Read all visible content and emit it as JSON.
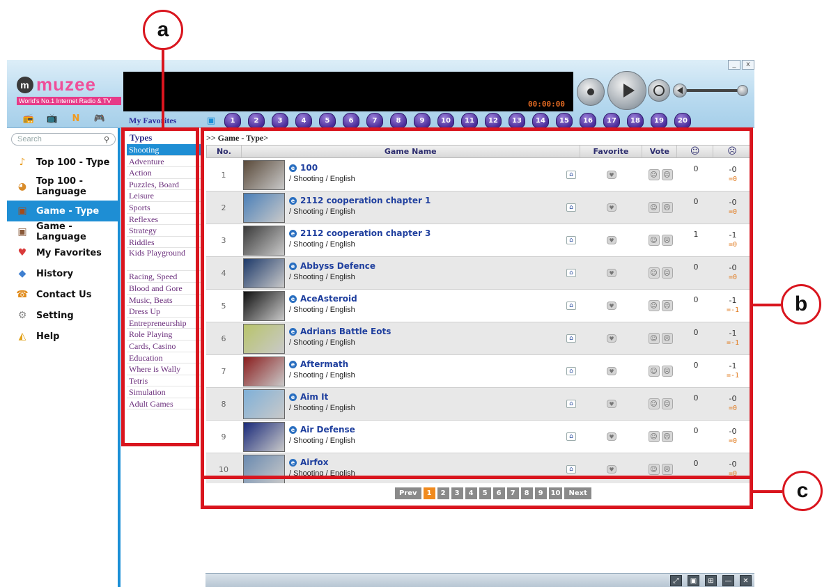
{
  "callouts": {
    "a": "a",
    "b": "b",
    "c": "c"
  },
  "app": {
    "logo": {
      "word": "muzee",
      "mark": "m",
      "tagline": "World's No.1 Internet Radio & TV"
    },
    "player": {
      "timer": "00:00:00"
    },
    "window_buttons": [
      "_",
      "x"
    ],
    "favorites": {
      "label": "My Favorites",
      "slots": [
        "1",
        "2",
        "3",
        "4",
        "5",
        "6",
        "7",
        "8",
        "9",
        "10",
        "11",
        "12",
        "13",
        "14",
        "15",
        "16",
        "17",
        "18",
        "19",
        "20"
      ]
    },
    "mode_icons": [
      {
        "name": "radio-icon",
        "glyph": "📻",
        "color": "#1b8fd6"
      },
      {
        "name": "tv-icon",
        "glyph": "📺",
        "color": "#d12a5c"
      },
      {
        "name": "news-icon",
        "glyph": "N",
        "color": "#f19a1e"
      },
      {
        "name": "game-icon",
        "glyph": "🎮",
        "color": "#d9307a"
      }
    ]
  },
  "sidebar": {
    "search_placeholder": "Search",
    "items": [
      {
        "label": "Top 100 - Type",
        "icon": "music-notes-icon",
        "glyph": "♪",
        "color": "#e89a1a"
      },
      {
        "label": "Top 100 - Language",
        "icon": "globe-notes-icon",
        "glyph": "◕",
        "color": "#d98c2a"
      },
      {
        "label": "Game - Type",
        "icon": "game-box-icon",
        "glyph": "▣",
        "color": "#a44c1a",
        "active": true
      },
      {
        "label": "Game - Language",
        "icon": "game-box-icon",
        "glyph": "▣",
        "color": "#8a5a3a"
      },
      {
        "label": "My Favorites",
        "icon": "heart-icon",
        "glyph": "♥",
        "color": "#d93a3a"
      },
      {
        "label": "History",
        "icon": "history-icon",
        "glyph": "◆",
        "color": "#3f7fd0"
      },
      {
        "label": "Contact Us",
        "icon": "contact-icon",
        "glyph": "☎",
        "color": "#e08a1a"
      },
      {
        "label": "Setting",
        "icon": "gear-icon",
        "glyph": "⚙",
        "color": "#8a8a8a"
      },
      {
        "label": "Help",
        "icon": "help-icon",
        "glyph": "◭",
        "color": "#e2a21a"
      }
    ]
  },
  "types": {
    "heading": "Types",
    "items": [
      "Shooting",
      "Adventure",
      "Action",
      "Puzzles, Board",
      "Leisure",
      "Sports",
      "Reflexes",
      "Strategy",
      "Riddles",
      "Kids Playground",
      "Racing, Speed",
      "Blood and Gore",
      "Music, Beats",
      "Dress Up",
      "Entrepreneurship",
      "Role Playing",
      "Cards, Casino",
      "Education",
      "Where is Wally",
      "Tetris",
      "Simulation",
      "Adult Games"
    ]
  },
  "main": {
    "breadcrumb": ">> Game - Type>",
    "columns": {
      "no": "No.",
      "name": "Game Name",
      "favorite": "Favorite",
      "vote": "Vote",
      "up": "☺",
      "down": "☹"
    },
    "games": [
      {
        "no": "1",
        "title": "100",
        "meta": "/ Shooting / English",
        "up": "0",
        "down": "-0",
        "score": "=0",
        "thumb": "#5a4a3a"
      },
      {
        "no": "2",
        "title": "2112 cooperation chapter 1",
        "meta": "/ Shooting / English",
        "up": "0",
        "down": "-0",
        "score": "=0",
        "thumb": "#4a7fb8"
      },
      {
        "no": "3",
        "title": "2112 cooperation chapter 3",
        "meta": "/ Shooting / English",
        "up": "1",
        "down": "-1",
        "score": "=0",
        "thumb": "#3a3a3a"
      },
      {
        "no": "4",
        "title": "Abbyss Defence",
        "meta": "/ Shooting / English",
        "up": "0",
        "down": "-0",
        "score": "=0",
        "thumb": "#1e3a6a"
      },
      {
        "no": "5",
        "title": "AceAsteroid",
        "meta": "/ Shooting / English",
        "up": "0",
        "down": "-1",
        "score": "=-1",
        "thumb": "#101010"
      },
      {
        "no": "6",
        "title": "Adrians Battle Eots",
        "meta": "/ Shooting / English",
        "up": "0",
        "down": "-1",
        "score": "=-1",
        "thumb": "#b8c46a"
      },
      {
        "no": "7",
        "title": "Aftermath",
        "meta": "/ Shooting / English",
        "up": "0",
        "down": "-1",
        "score": "=-1",
        "thumb": "#8a1e1e"
      },
      {
        "no": "8",
        "title": "Aim It",
        "meta": "/ Shooting / English",
        "up": "0",
        "down": "-0",
        "score": "=0",
        "thumb": "#7fb0d8"
      },
      {
        "no": "9",
        "title": "Air Defense",
        "meta": "/ Shooting / English",
        "up": "0",
        "down": "-0",
        "score": "=0",
        "thumb": "#1a2a7a"
      },
      {
        "no": "10",
        "title": "Airfox",
        "meta": "/ Shooting / English",
        "up": "0",
        "down": "-0",
        "score": "=0",
        "thumb": "#6a8ab0"
      }
    ],
    "pager": {
      "prev": "Prev",
      "pages": [
        "1",
        "2",
        "3",
        "4",
        "5",
        "6",
        "7",
        "8",
        "9",
        "10"
      ],
      "current": "1",
      "next": "Next"
    }
  },
  "bottom_bar": [
    "⤢",
    "▣",
    "⊞",
    "—",
    "✕"
  ]
}
